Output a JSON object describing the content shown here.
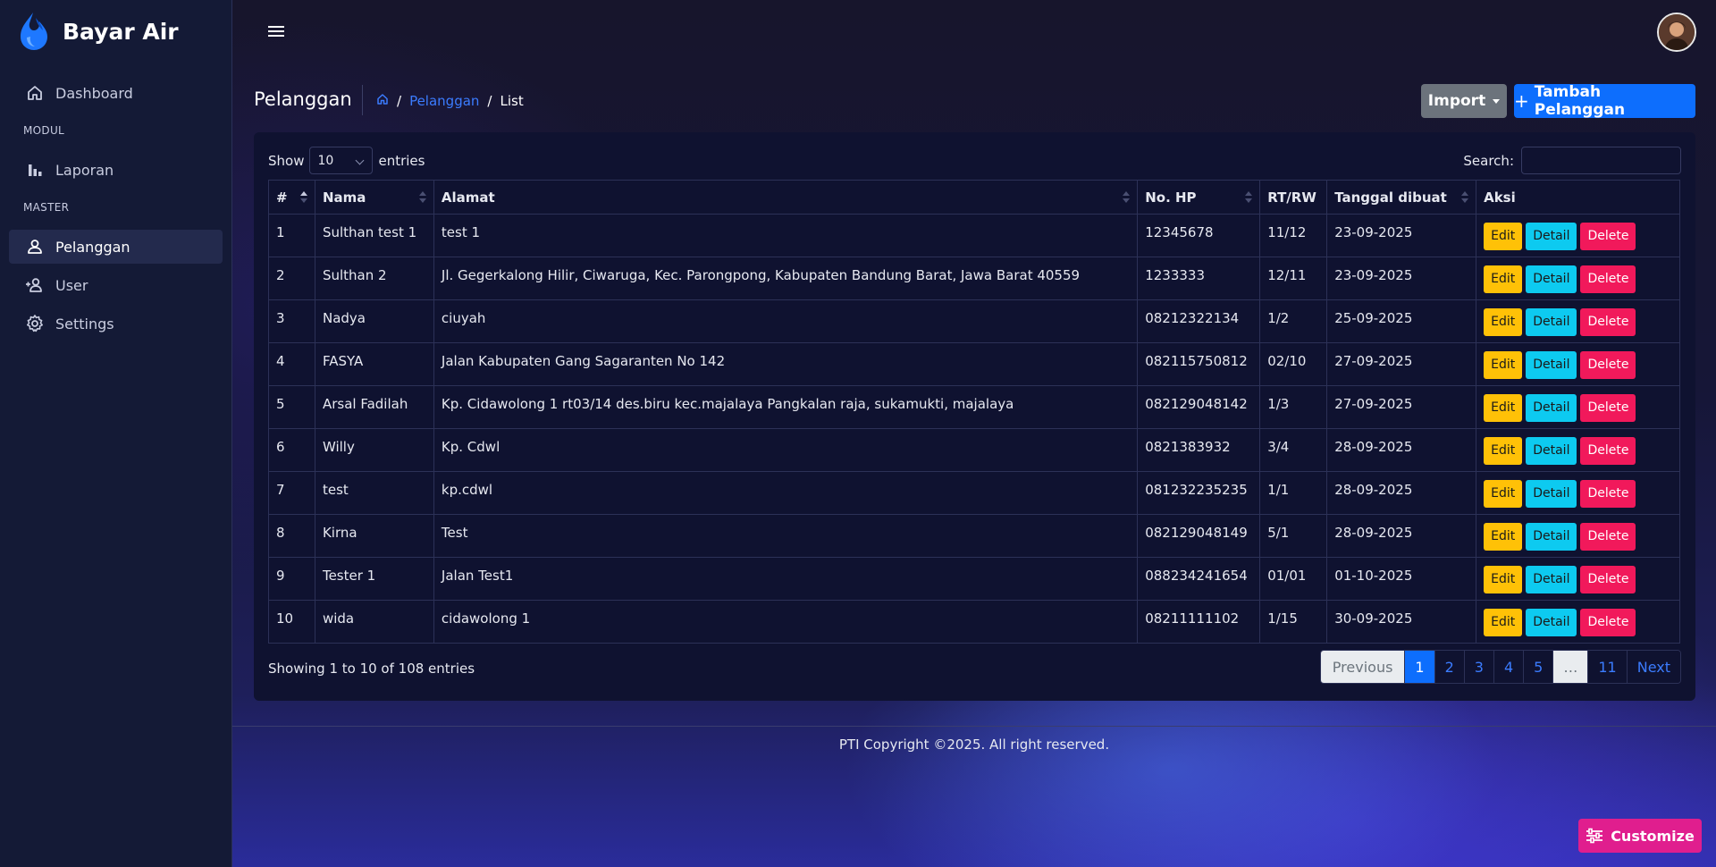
{
  "app": {
    "name": "Bayar Air"
  },
  "sidebar": {
    "items": [
      {
        "label": "Dashboard",
        "icon": "home-icon"
      },
      {
        "section": "MODUL"
      },
      {
        "label": "Laporan",
        "icon": "bar-chart-icon"
      },
      {
        "section": "MASTER"
      },
      {
        "label": "Pelanggan",
        "icon": "user-icon",
        "active": true
      },
      {
        "label": "User",
        "icon": "user-add-icon"
      },
      {
        "label": "Settings",
        "icon": "gear-icon"
      }
    ]
  },
  "header": {
    "title": "Pelanggan",
    "breadcrumb": {
      "home_icon": "home-icon",
      "link": "Pelanggan",
      "current": "List"
    },
    "import_label": "Import",
    "add_label": "Tambah Pelanggan"
  },
  "table_controls": {
    "show_label": "Show",
    "entries_value": "10",
    "entries_label": "entries",
    "search_label": "Search:",
    "search_value": ""
  },
  "table": {
    "columns": [
      "#",
      "Nama",
      "Alamat",
      "No. HP",
      "RT/RW",
      "Tanggal dibuat",
      "Aksi"
    ],
    "rows": [
      {
        "no": "1",
        "nama": "Sulthan test 1",
        "alamat": "test 1",
        "hp": "12345678",
        "rtrw": "11/12",
        "tanggal": "23-09-2025"
      },
      {
        "no": "2",
        "nama": "Sulthan 2",
        "alamat": "Jl. Gegerkalong Hilir, Ciwaruga, Kec. Parongpong, Kabupaten Bandung Barat, Jawa Barat 40559",
        "hp": "1233333",
        "rtrw": "12/11",
        "tanggal": "23-09-2025"
      },
      {
        "no": "3",
        "nama": "Nadya",
        "alamat": "ciuyah",
        "hp": "08212322134",
        "rtrw": "1/2",
        "tanggal": "25-09-2025"
      },
      {
        "no": "4",
        "nama": "FASYA",
        "alamat": "Jalan Kabupaten Gang Sagaranten No 142",
        "hp": "082115750812",
        "rtrw": "02/10",
        "tanggal": "27-09-2025"
      },
      {
        "no": "5",
        "nama": "Arsal Fadilah",
        "alamat": "Kp. Cidawolong 1 rt03/14 des.biru kec.majalaya Pangkalan raja, sukamukti, majalaya",
        "hp": "082129048142",
        "rtrw": "1/3",
        "tanggal": "27-09-2025"
      },
      {
        "no": "6",
        "nama": "Willy",
        "alamat": "Kp. Cdwl",
        "hp": "0821383932",
        "rtrw": "3/4",
        "tanggal": "28-09-2025"
      },
      {
        "no": "7",
        "nama": "test",
        "alamat": "kp.cdwl",
        "hp": "081232235235",
        "rtrw": "1/1",
        "tanggal": "28-09-2025"
      },
      {
        "no": "8",
        "nama": "Kirna",
        "alamat": "Test",
        "hp": "082129048149",
        "rtrw": "5/1",
        "tanggal": "28-09-2025"
      },
      {
        "no": "9",
        "nama": "Tester 1",
        "alamat": "Jalan Test1",
        "hp": "088234241654",
        "rtrw": "01/01",
        "tanggal": "01-10-2025"
      },
      {
        "no": "10",
        "nama": "wida",
        "alamat": "cidawolong 1",
        "hp": "08211111102",
        "rtrw": "1/15",
        "tanggal": "30-09-2025"
      }
    ],
    "actions": {
      "edit": "Edit",
      "detail": "Detail",
      "delete": "Delete"
    }
  },
  "pagination": {
    "info": "Showing 1 to 10 of 108 entries",
    "prev": "Previous",
    "pages": [
      "1",
      "2",
      "3",
      "4",
      "5",
      "…",
      "11"
    ],
    "current": "1",
    "next": "Next"
  },
  "footer": {
    "text": "PTI Copyright ©2025. All right reserved."
  },
  "customize_label": "Customize",
  "colors": {
    "accent": "#0d6efd",
    "edit": "#ffc107",
    "detail": "#0dcaf0",
    "delete": "#f1195b",
    "customize": "#e01e8e"
  }
}
